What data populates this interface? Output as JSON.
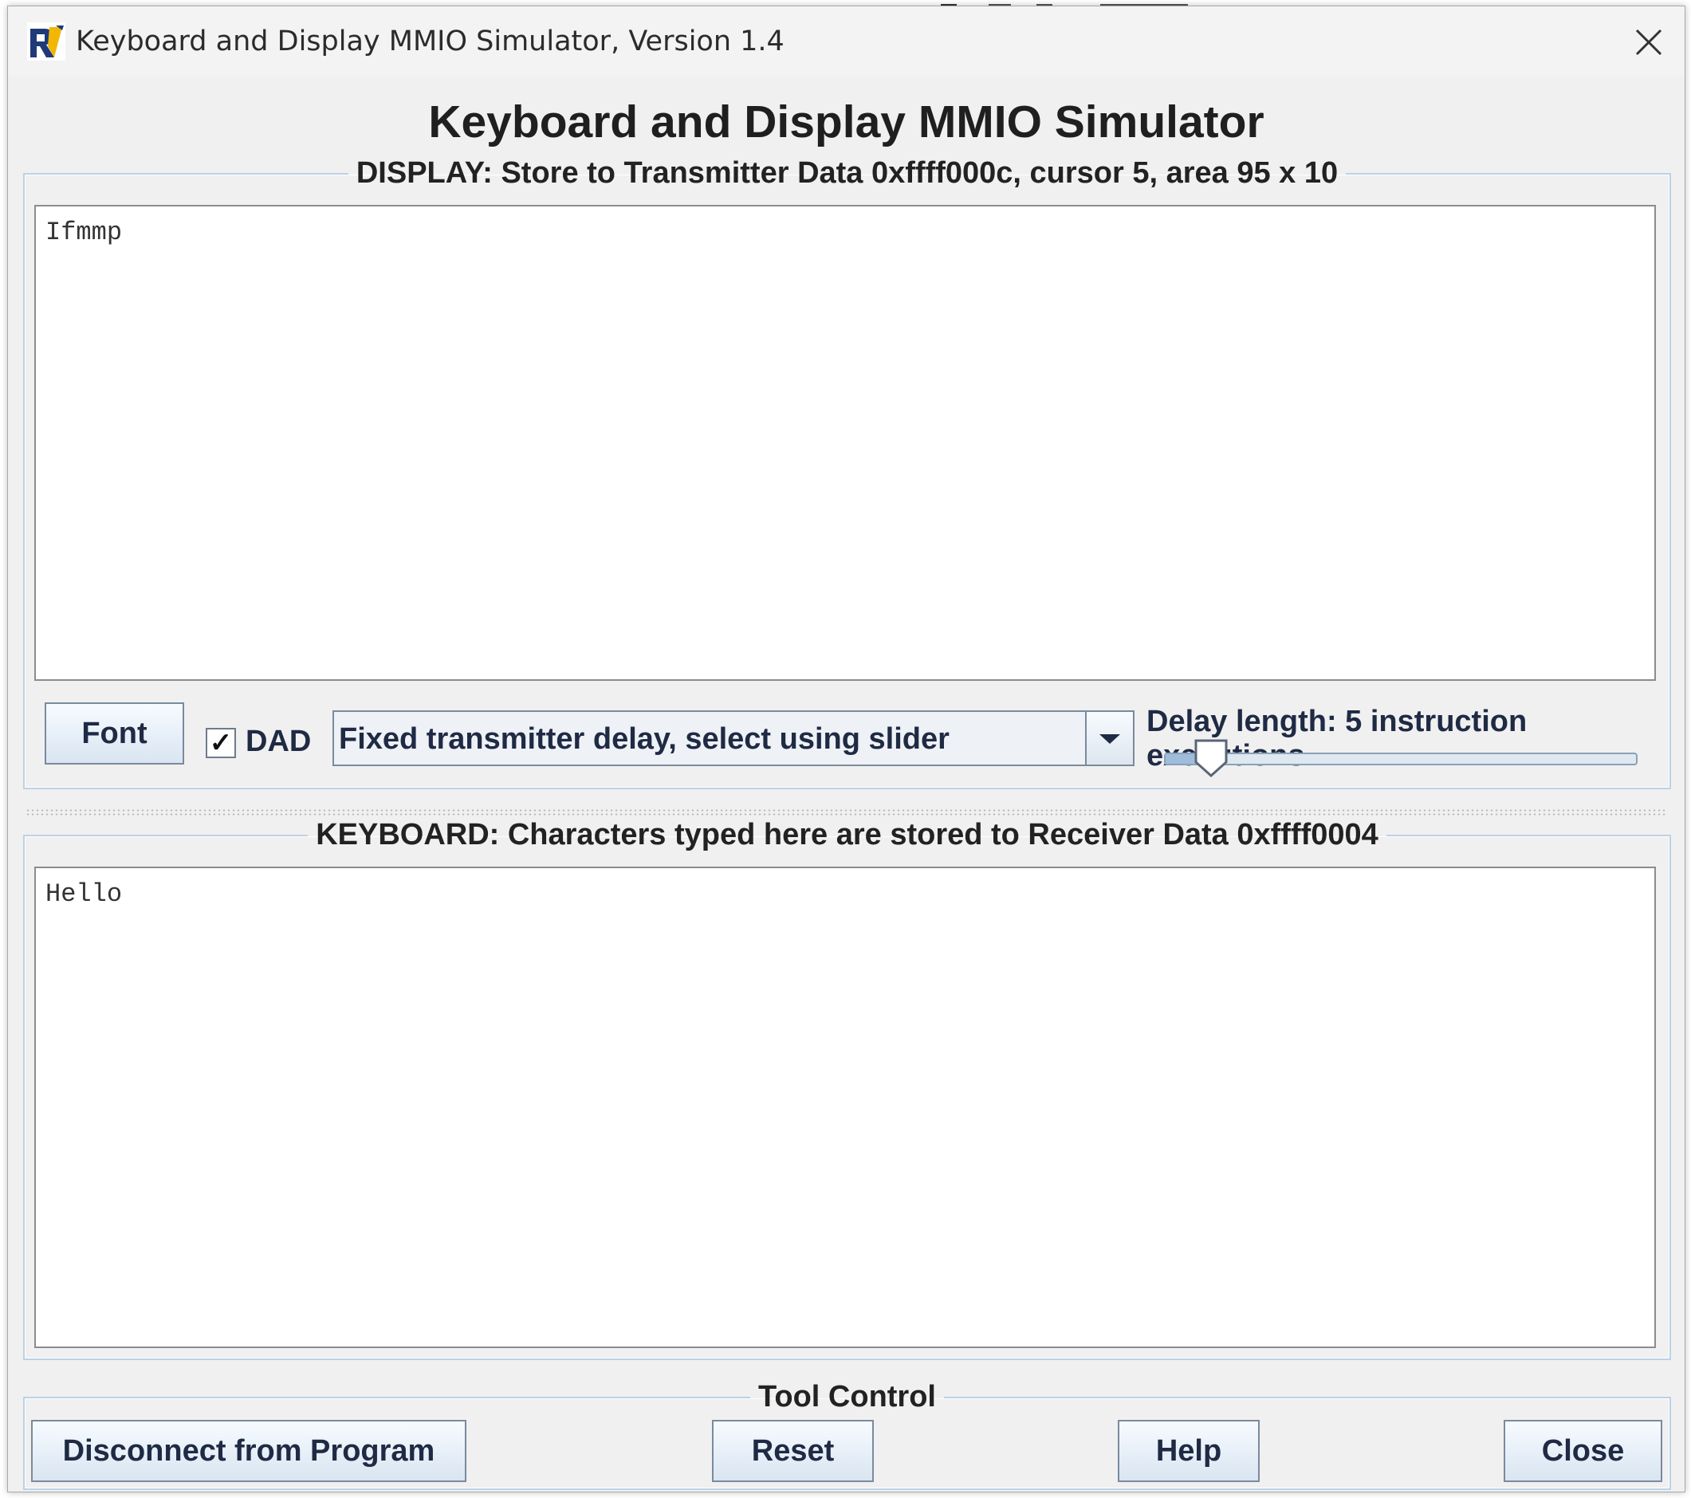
{
  "window": {
    "title": "Keyboard and Display MMIO Simulator, Version 1.4",
    "heading": "Keyboard and Display MMIO Simulator"
  },
  "display": {
    "legend": "DISPLAY: Store to Transmitter Data 0xffff000c, cursor 5, area 95 x 10",
    "text": "Ifmmp",
    "font_button": "Font",
    "dad_label": "DAD",
    "dad_checked": true,
    "delay_mode": "Fixed transmitter delay, select using slider",
    "delay_label": "Delay length: 5 instruction executions",
    "delay_slider_fraction": 0.1
  },
  "keyboard": {
    "legend": "KEYBOARD: Characters typed here are stored to Receiver Data 0xffff0004",
    "text": "Hello"
  },
  "tool_control": {
    "legend": "Tool Control",
    "disconnect": "Disconnect from Program",
    "reset": "Reset",
    "help": "Help",
    "close": "Close"
  },
  "icons": [
    "app-logo-icon",
    "close-icon",
    "checkbox-check-icon",
    "dropdown-arrow-icon",
    "slider-thumb-icon"
  ]
}
